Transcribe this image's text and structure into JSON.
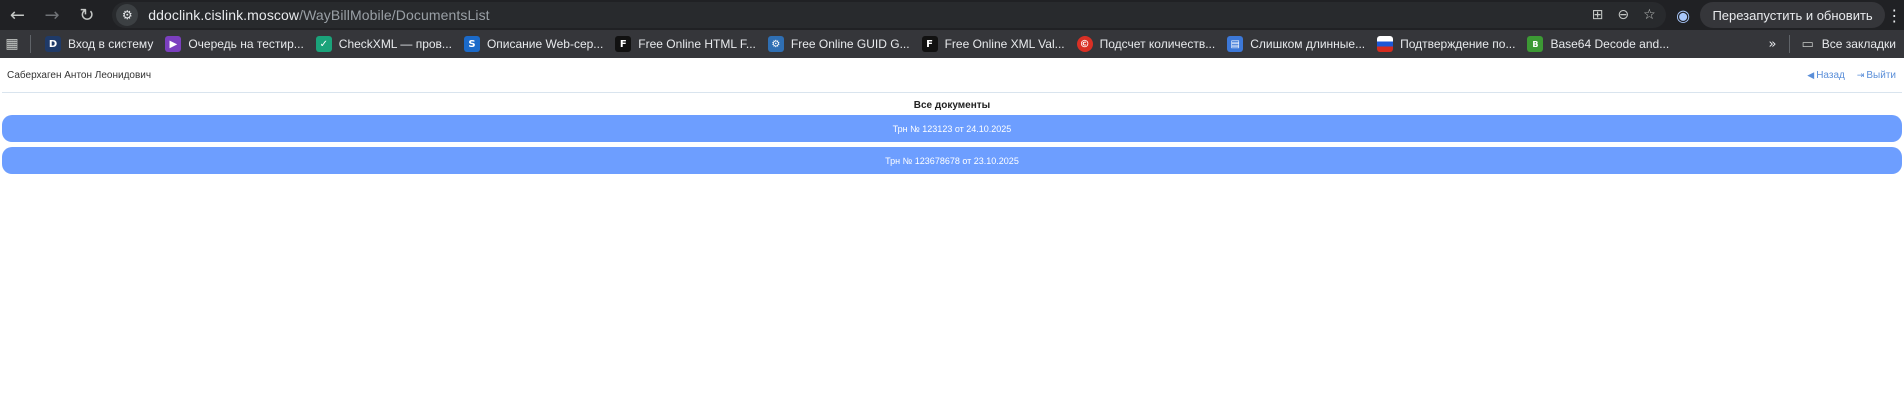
{
  "browser": {
    "url_domain": "ddoclink.cislink.moscow",
    "url_path": "/WayBillMobile/DocumentsList",
    "restart_label": "Перезапустить и обновить"
  },
  "bookmarks": [
    {
      "label": "Вход в систему",
      "icon": "D",
      "color": "#1f3a68"
    },
    {
      "label": "Очередь на тестир...",
      "icon": "VS",
      "color": "#7b3fbf"
    },
    {
      "label": "CheckXML — пров...",
      "icon": "C",
      "color": "#1aa37a"
    },
    {
      "label": "Описание Web-сер...",
      "icon": "S",
      "color": "#1b6ac9"
    },
    {
      "label": "Free Online HTML F...",
      "icon": "FF",
      "color": "#111111"
    },
    {
      "label": "Free Online GUID G...",
      "icon": "G",
      "color": "#2f6fb3"
    },
    {
      "label": "Free Online XML Val...",
      "icon": "FF",
      "color": "#111111"
    },
    {
      "label": "Подсчет количеств...",
      "icon": "C",
      "color": "#d93025"
    },
    {
      "label": "Слишком длинные...",
      "icon": "W",
      "color": "#3c78d8"
    },
    {
      "label": "Подтверждение по...",
      "icon": "RU",
      "color": "#d52b1e"
    },
    {
      "label": "Base64 Decode and...",
      "icon": "64",
      "color": "#3c9a34"
    }
  ],
  "all_bookmarks_label": "Все закладки",
  "page": {
    "user_name": "Саберхаген Антон Леонидович",
    "back_label": "Назад",
    "logout_label": "Выйти",
    "section_title": "Все документы",
    "documents": [
      {
        "label": "Трн № 123123 от 24.10.2025"
      },
      {
        "label": "Трн № 123678678 от 23.10.2025"
      }
    ]
  },
  "colors": {
    "doc_button": "#6d9eff",
    "link": "#5b8fd9",
    "toolbar_bg": "#202124",
    "bookmarks_bg": "#35363a"
  }
}
